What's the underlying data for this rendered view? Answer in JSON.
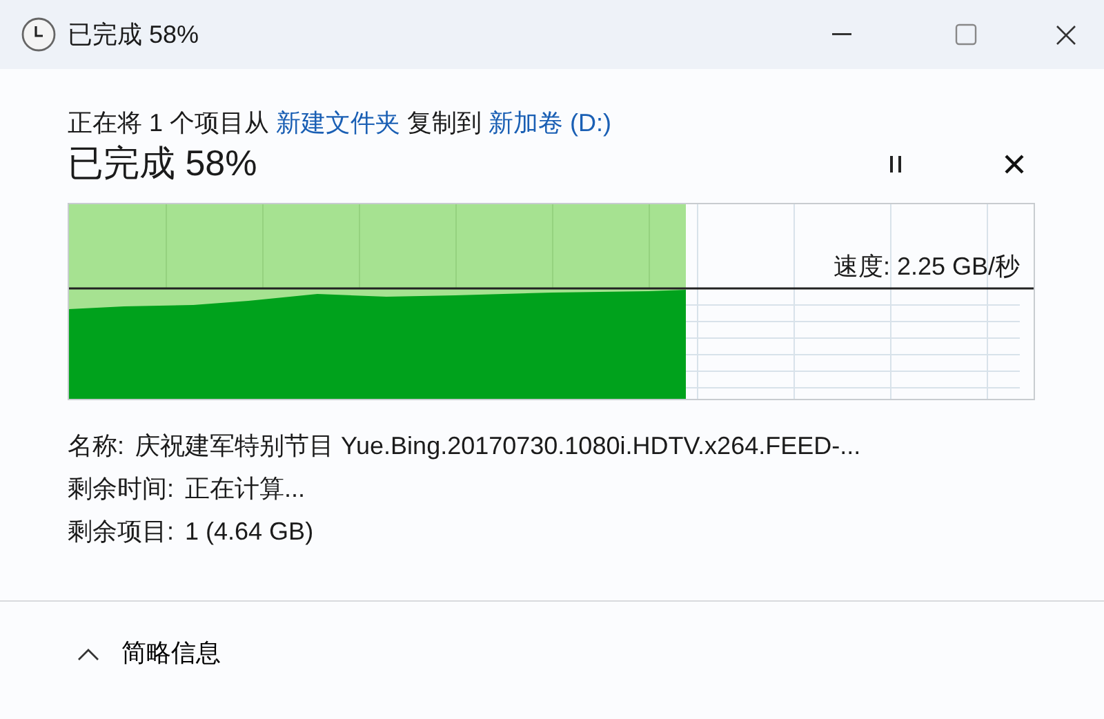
{
  "window": {
    "title": "已完成 58%"
  },
  "status_line": {
    "prefix": "正在将 1 个项目从",
    "source": "新建文件夹",
    "middle": "复制到",
    "destination": "新加卷 (D:)"
  },
  "heading": "已完成 58%",
  "chart": {
    "level": 0.64,
    "speed": "速度: 2.25 GB/秒"
  },
  "details": [
    {
      "label": "名称:",
      "value": "庆祝建军特别节目 Yue.Bing.20170730.1080i.HDTV.x264.FEED-..."
    },
    {
      "label": "剩余时间:",
      "value": "正在计算..."
    },
    {
      "label": "剩余项目:",
      "value": "1 (4.64 GB)"
    }
  ],
  "footer": {
    "label": "简略信息",
    "expanded": true
  }
}
